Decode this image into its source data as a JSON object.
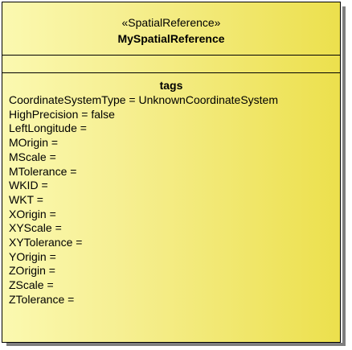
{
  "uml_class": {
    "stereotype": "«SpatialReference»",
    "name": "MySpatialReference",
    "attributes": [],
    "tags_title": "tags",
    "tags": [
      "CoordinateSystemType = UnknownCoordinateSystem",
      "HighPrecision = false",
      "LeftLongitude =",
      "MOrigin =",
      "MScale =",
      "MTolerance =",
      "WKID =",
      "WKT =",
      "XOrigin =",
      "XYScale =",
      "XYTolerance =",
      "YOrigin =",
      "ZOrigin =",
      "ZScale =",
      "ZTolerance ="
    ]
  },
  "colors": {
    "fill_light": "#fbf9b0",
    "fill_dark": "#ece04d",
    "border": "#000000",
    "shadow": "#7f7f7f"
  }
}
